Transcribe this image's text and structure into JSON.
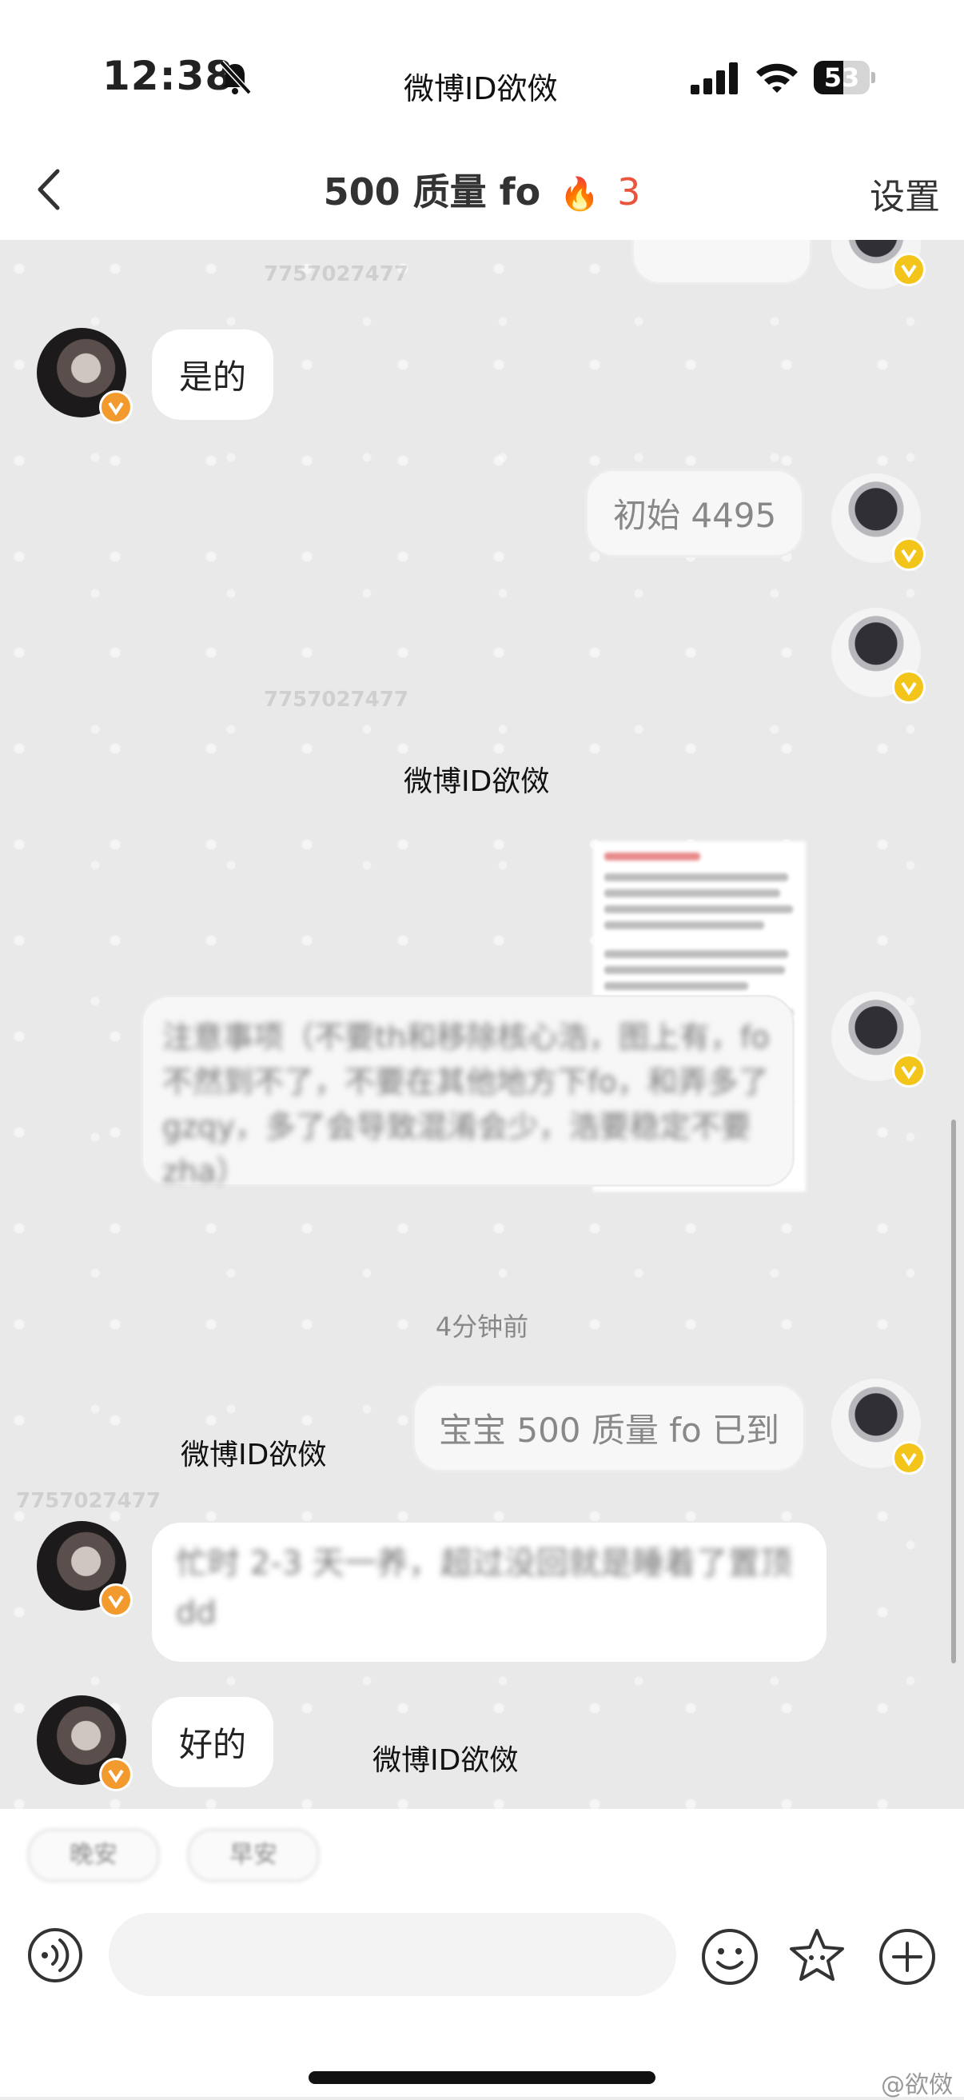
{
  "status_bar": {
    "time": "12:38",
    "watermark": "微博ID欲傚",
    "battery": "53",
    "battery_level": 0.53
  },
  "nav": {
    "title": "500 质量 fo",
    "fire_count": "3",
    "settings_label": "设置"
  },
  "chat": {
    "messages": [
      {
        "side": "left",
        "text": "是的"
      },
      {
        "side": "right",
        "text": "初始 4495"
      },
      {
        "side": "right",
        "text": "注意事项（不要th和移除核心浩，图上有，fo不然到不了，不要在其他地方下fo，和弄多了gzqy，多了会导致混淆会少，浩要稳定不要zha）"
      },
      {
        "side": "right",
        "text": "宝宝 500 质量 fo 已到"
      },
      {
        "side": "left",
        "text": "忙时 2-3 天一养，超过没回就是睡着了置顶dd"
      },
      {
        "side": "left",
        "text": "好的"
      }
    ],
    "timestamp": "4分钟前",
    "watermarks": [
      "微博ID欲傚",
      "微博ID欲傚",
      "微博ID欲傚"
    ],
    "background_watermark": "7757027477"
  },
  "bottom": {
    "chips": [
      "晚安",
      "早安"
    ],
    "credit": "@欲傚"
  }
}
